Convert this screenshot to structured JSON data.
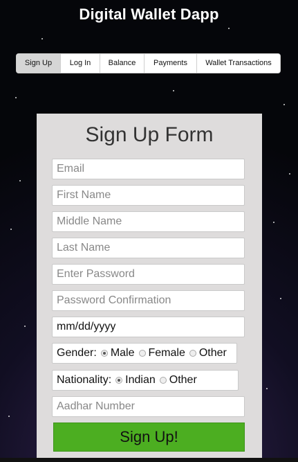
{
  "app": {
    "title": "Digital Wallet Dapp"
  },
  "nav": {
    "tabs": [
      {
        "label": "Sign Up",
        "active": true
      },
      {
        "label": "Log In"
      },
      {
        "label": "Balance"
      },
      {
        "label": "Payments"
      },
      {
        "label": "Wallet Transactions"
      }
    ]
  },
  "form": {
    "title": "Sign Up Form",
    "fields": {
      "email_placeholder": "Email",
      "first_name_placeholder": "First Name",
      "middle_name_placeholder": "Middle Name",
      "last_name_placeholder": "Last Name",
      "password_placeholder": "Enter Password",
      "password_confirm_placeholder": "Password Confirmation",
      "date_value": "mm/dd/yyyy",
      "aadhar_placeholder": "Aadhar Number"
    },
    "gender": {
      "label": "Gender:",
      "options": [
        "Male",
        "Female",
        "Other"
      ],
      "selected": "Male"
    },
    "nationality": {
      "label": "Nationality:",
      "options": [
        "Indian",
        "Other"
      ],
      "selected": "Indian"
    },
    "submit_label": "Sign Up!"
  },
  "colors": {
    "submit_bg": "#4cae21",
    "form_bg": "#dedcdc",
    "tab_active_bg": "#d6d6d6"
  }
}
